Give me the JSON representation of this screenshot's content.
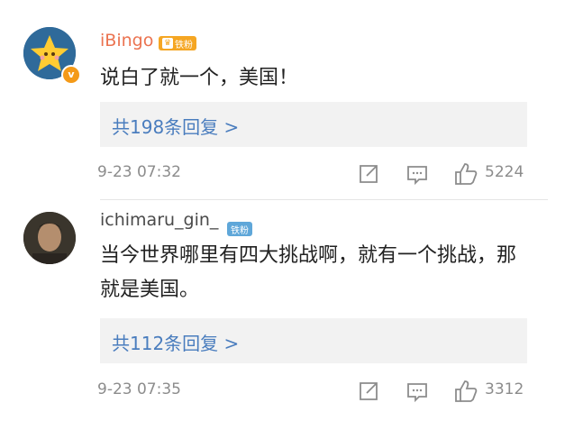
{
  "comments": [
    {
      "username": "iBingo",
      "badge": "铁粉",
      "verified_mark": "v",
      "avatar": "star-face-icon",
      "text": "说白了就一个，美国！",
      "replies_label": "共198条回复 >",
      "time": "9-23 07:32",
      "likes": "5224",
      "colors": {
        "username": "#eb7350",
        "badge": "#f5a623"
      }
    },
    {
      "username": "ichimaru_gin_",
      "badge": "铁粉",
      "avatar": "man-portrait-icon",
      "text": "当今世界哪里有四大挑战啊，就有一个挑战，那就是美国。",
      "replies_label": "共112条回复 >",
      "time": "9-23 07:35",
      "likes": "3312",
      "colors": {
        "username": "#4a4a4a",
        "badge": "#5fa7d9"
      }
    }
  ],
  "colors": {
    "link": "#4a7dbe",
    "meta": "#8c8c8c",
    "reply_bg": "#f2f2f2"
  }
}
